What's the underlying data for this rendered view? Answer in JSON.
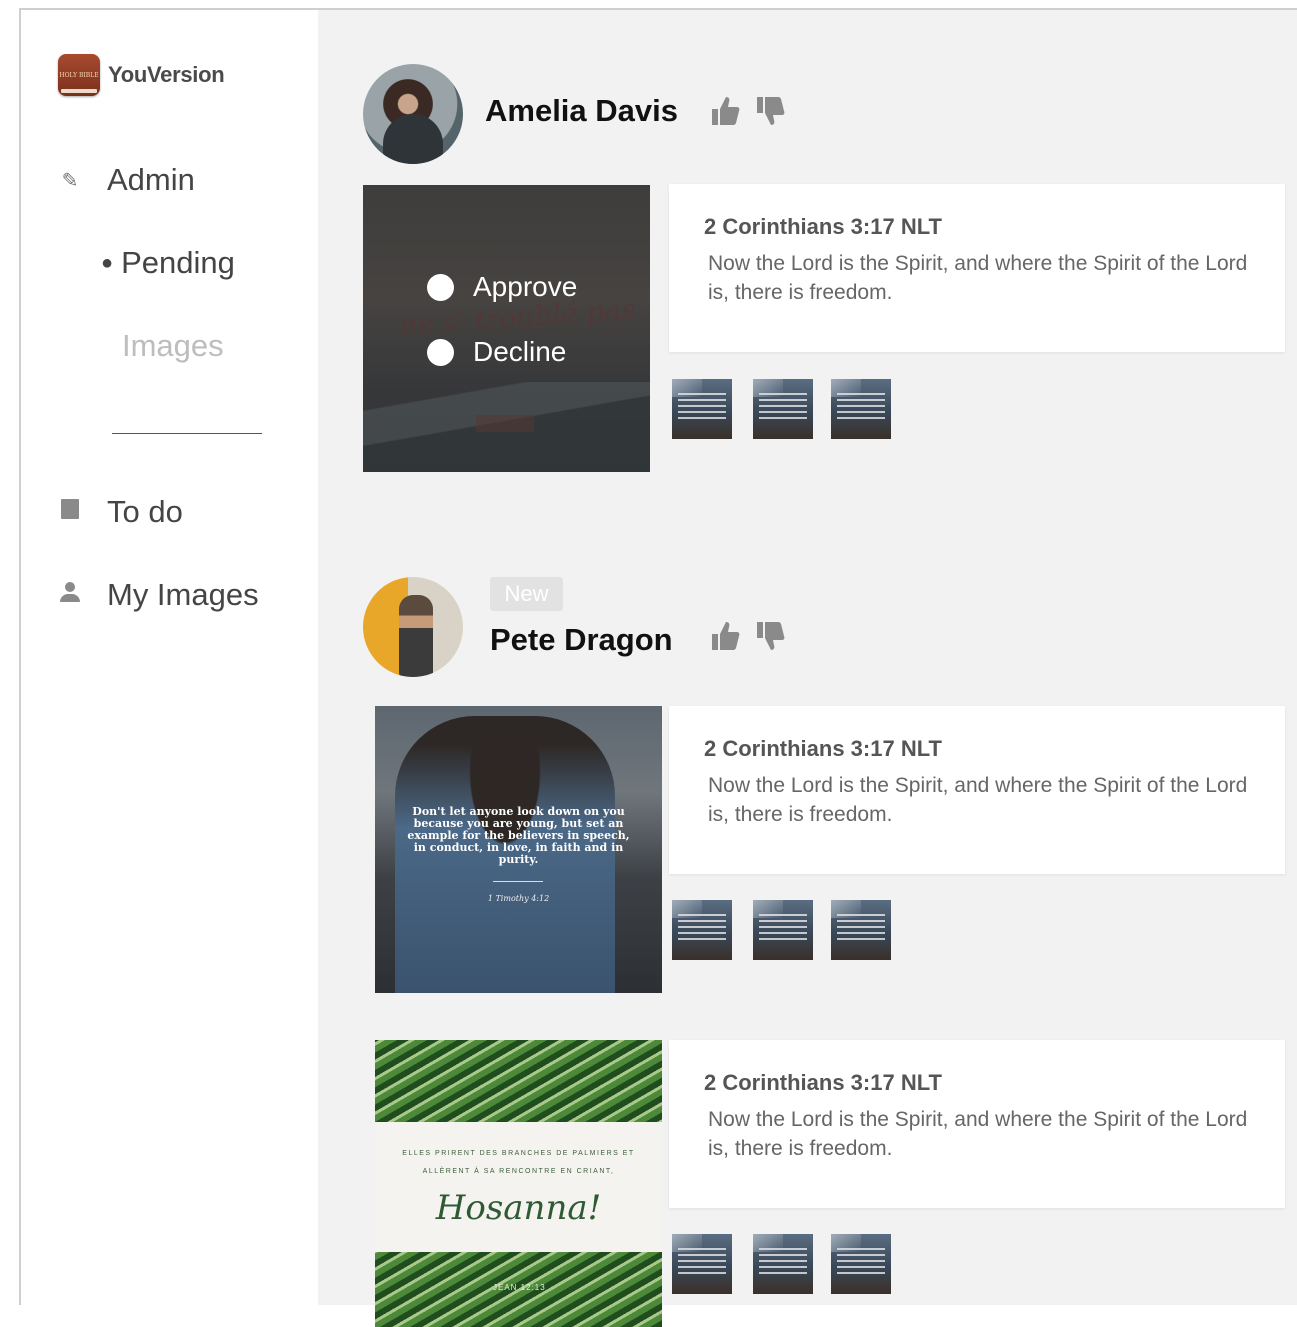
{
  "app": {
    "brand": "YouVersion",
    "logo_text": "HOLY BIBLE"
  },
  "sidebar": {
    "admin_label": "Admin",
    "pending_label": "Pending",
    "images_label": "Images",
    "todo_label": "To do",
    "my_images_label": "My Images"
  },
  "submissions": [
    {
      "user": "Amelia Davis",
      "badge": "",
      "moderation": {
        "approve_label": "Approve",
        "decline_label": "Decline"
      },
      "posts": [
        {
          "reference": "2 Corinthians 3:17 NLT",
          "verse": "Now the Lord is the Spirit, and where the Spirit of the Lord is, there is freedom."
        }
      ]
    },
    {
      "user": "Pete Dragon",
      "badge": "New",
      "posts": [
        {
          "image_quote": "Don't let anyone look down on you because you are young, but set an example for the believers in speech, in conduct, in love, in faith and in purity.",
          "image_ref": "1 Timothy 4:12",
          "reference": "2 Corinthians 3:17 NLT",
          "verse": "Now the Lord is the Spirit, and where the Spirit of the Lord is, there is freedom."
        },
        {
          "image_line1": "ELLES PRIRENT DES BRANCHES DE PALMIERS ET",
          "image_line2": "ALLÈRENT À SA RENCONTRE EN CRIANT,",
          "image_title": "Hosanna!",
          "image_ref": "JEAN 12:13",
          "reference": "2 Corinthians 3:17 NLT",
          "verse": "Now the Lord is the Spirit, and where the Spirit of the Lord is, there is freedom."
        }
      ]
    }
  ],
  "icons": {
    "admin": "pencil-icon",
    "todo": "square-icon",
    "my_images": "user-icon",
    "like": "thumbs-up-icon",
    "dislike": "thumbs-down-icon"
  },
  "colors": {
    "main_bg": "#f2f2f2",
    "sidebar_bg": "#ffffff",
    "text_dark": "#111111",
    "muted": "#bdbdbd"
  }
}
